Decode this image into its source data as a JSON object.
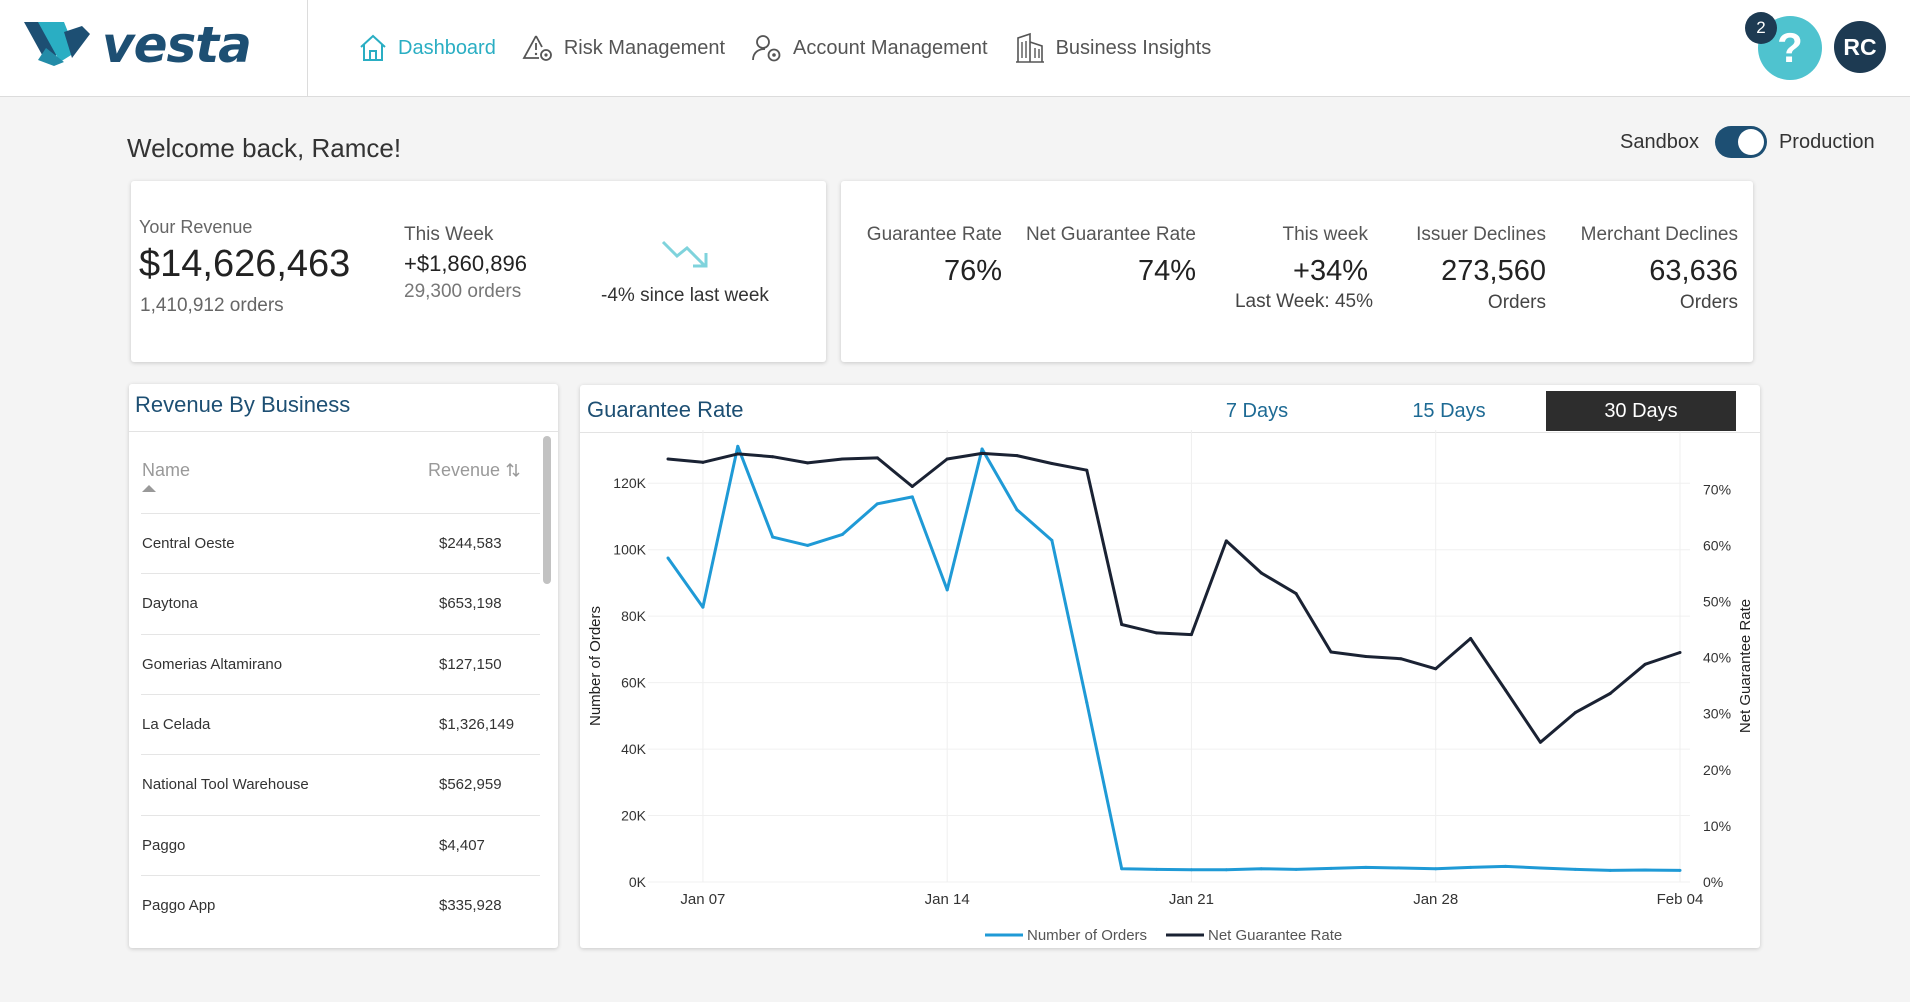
{
  "header": {
    "logo_text": "vesta",
    "nav": [
      {
        "label": "Dashboard",
        "icon": "home-icon",
        "active": true
      },
      {
        "label": "Risk Management",
        "icon": "risk-icon",
        "active": false
      },
      {
        "label": "Account Management",
        "icon": "account-icon",
        "active": false
      },
      {
        "label": "Business Insights",
        "icon": "building-icon",
        "active": false
      }
    ],
    "help_badge": "2",
    "help_glyph": "?",
    "avatar": "RC",
    "accent": "#2aaec3",
    "brand": "#1d4f73"
  },
  "welcome": "Welcome back, Ramce!",
  "environment": {
    "left": "Sandbox",
    "right": "Production",
    "production_on": true
  },
  "revenue": {
    "label": "Your Revenue",
    "value": "$14,626,463",
    "orders": "1,410,912 orders",
    "week_label": "This Week",
    "week_value": "+$1,860,896",
    "week_orders": "29,300 orders",
    "trend": "-4% since last week"
  },
  "stats": {
    "guarantee_label": "Guarantee Rate",
    "guarantee_value": "76%",
    "net_label": "Net Guarantee Rate",
    "net_value": "74%",
    "week_label": "This week",
    "week_value": "+34%",
    "last_week_label": "Last Week:",
    "last_week_value": "45%",
    "issuer_label": "Issuer Declines",
    "issuer_value": "273,560",
    "issuer_unit": "Orders",
    "merchant_label": "Merchant Declines",
    "merchant_value": "63,636",
    "merchant_unit": "Orders"
  },
  "business": {
    "title": "Revenue By Business",
    "col_name": "Name",
    "col_revenue": "Revenue",
    "rows": [
      {
        "name": "Central Oeste",
        "revenue": "$244,583"
      },
      {
        "name": "Daytona",
        "revenue": "$653,198"
      },
      {
        "name": "Gomerias Altamirano",
        "revenue": "$127,150"
      },
      {
        "name": "La Celada",
        "revenue": "$1,326,149"
      },
      {
        "name": "National Tool Warehouse",
        "revenue": "$562,959"
      },
      {
        "name": "Paggo",
        "revenue": "$4,407"
      },
      {
        "name": "Paggo App",
        "revenue": "$335,928"
      }
    ]
  },
  "guarantee_chart": {
    "title": "Guarantee Rate",
    "tabs": [
      "7 Days",
      "15 Days",
      "30 Days"
    ],
    "selected_tab": "30 Days"
  },
  "chart_data": {
    "type": "line",
    "title": "Guarantee Rate",
    "x": [
      "Jan 06",
      "Jan 07",
      "Jan 08",
      "Jan 09",
      "Jan 10",
      "Jan 11",
      "Jan 12",
      "Jan 13",
      "Jan 14",
      "Jan 15",
      "Jan 16",
      "Jan 17",
      "Jan 18",
      "Jan 19",
      "Jan 20",
      "Jan 21",
      "Jan 22",
      "Jan 23",
      "Jan 24",
      "Jan 25",
      "Jan 26",
      "Jan 27",
      "Jan 28",
      "Jan 29",
      "Jan 30",
      "Jan 31",
      "Feb 01",
      "Feb 02",
      "Feb 03",
      "Feb 04"
    ],
    "x_ticks": [
      "Jan 07",
      "Jan 14",
      "Jan 21",
      "Jan 28",
      "Feb 04"
    ],
    "y_left": {
      "label": "Number of Orders",
      "min": 0,
      "max": 130000,
      "ticks": [
        0,
        20000,
        40000,
        60000,
        80000,
        100000,
        120000
      ],
      "tick_labels": [
        "0K",
        "20K",
        "40K",
        "60K",
        "80K",
        "100K",
        "120K"
      ]
    },
    "y_right": {
      "label": "Net Guarantee Rate",
      "min": 0,
      "max": 0.77,
      "ticks": [
        0,
        0.1,
        0.2,
        0.3,
        0.4,
        0.5,
        0.6,
        0.7
      ],
      "tick_labels": [
        "0%",
        "10%",
        "20%",
        "30%",
        "40%",
        "50%",
        "60%",
        "70%"
      ]
    },
    "series": [
      {
        "name": "Number of Orders",
        "axis": "left",
        "color": "#1f9ad6",
        "values": [
          97500,
          82700,
          131100,
          103800,
          101300,
          104600,
          113800,
          115900,
          87900,
          130300,
          112000,
          102800,
          54000,
          4000,
          3800,
          3700,
          3700,
          4000,
          3800,
          4100,
          4400,
          4200,
          4000,
          4400,
          4700,
          4200,
          3800,
          3500,
          3600,
          3500
        ]
      },
      {
        "name": "Net Guarantee Rate",
        "axis": "right",
        "color": "#1a2233",
        "values": [
          0.754,
          0.748,
          0.763,
          0.758,
          0.747,
          0.754,
          0.756,
          0.705,
          0.754,
          0.764,
          0.76,
          0.746,
          0.734,
          0.459,
          0.444,
          0.441,
          0.608,
          0.551,
          0.514,
          0.41,
          0.402,
          0.398,
          0.38,
          0.434,
          0.342,
          0.249,
          0.302,
          0.336,
          0.388,
          0.409
        ]
      }
    ],
    "legend": "bottom",
    "grid": true
  }
}
